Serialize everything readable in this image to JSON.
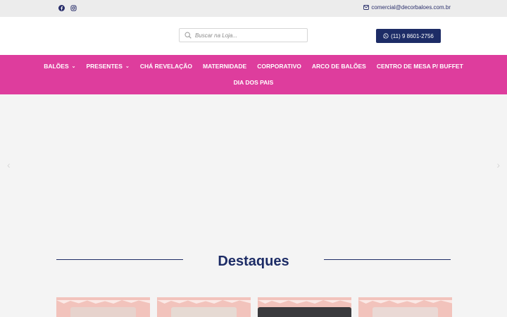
{
  "topbar": {
    "social": [
      "facebook-icon",
      "instagram-icon"
    ],
    "email": "comercial@decorbaloes.com.br"
  },
  "header": {
    "search_placeholder": "Buscar na Loja...",
    "whatsapp_label": "(11) 9 8601-2756"
  },
  "nav": {
    "row1": [
      {
        "label": "BALÕES",
        "dropdown": true
      },
      {
        "label": "PRESENTES",
        "dropdown": true
      },
      {
        "label": "CHÁ REVELAÇÃO",
        "dropdown": false
      },
      {
        "label": "MATERNIDADE",
        "dropdown": false
      },
      {
        "label": "CORPORATIVO",
        "dropdown": false
      },
      {
        "label": "ARCO DE BALÕES",
        "dropdown": false
      },
      {
        "label": "CENTRO DE MESA P/ BUFFET",
        "dropdown": false
      }
    ],
    "row2": [
      {
        "label": "DIA DOS PAIS",
        "dropdown": false
      }
    ]
  },
  "slider": {
    "prev_arrow": "‹",
    "next_arrow": "›"
  },
  "featured": {
    "title": "Destaques"
  },
  "colors": {
    "nav_bg": "#de3d9d",
    "brand_blue": "#1d2c66",
    "topbar_bg": "#ececec"
  }
}
